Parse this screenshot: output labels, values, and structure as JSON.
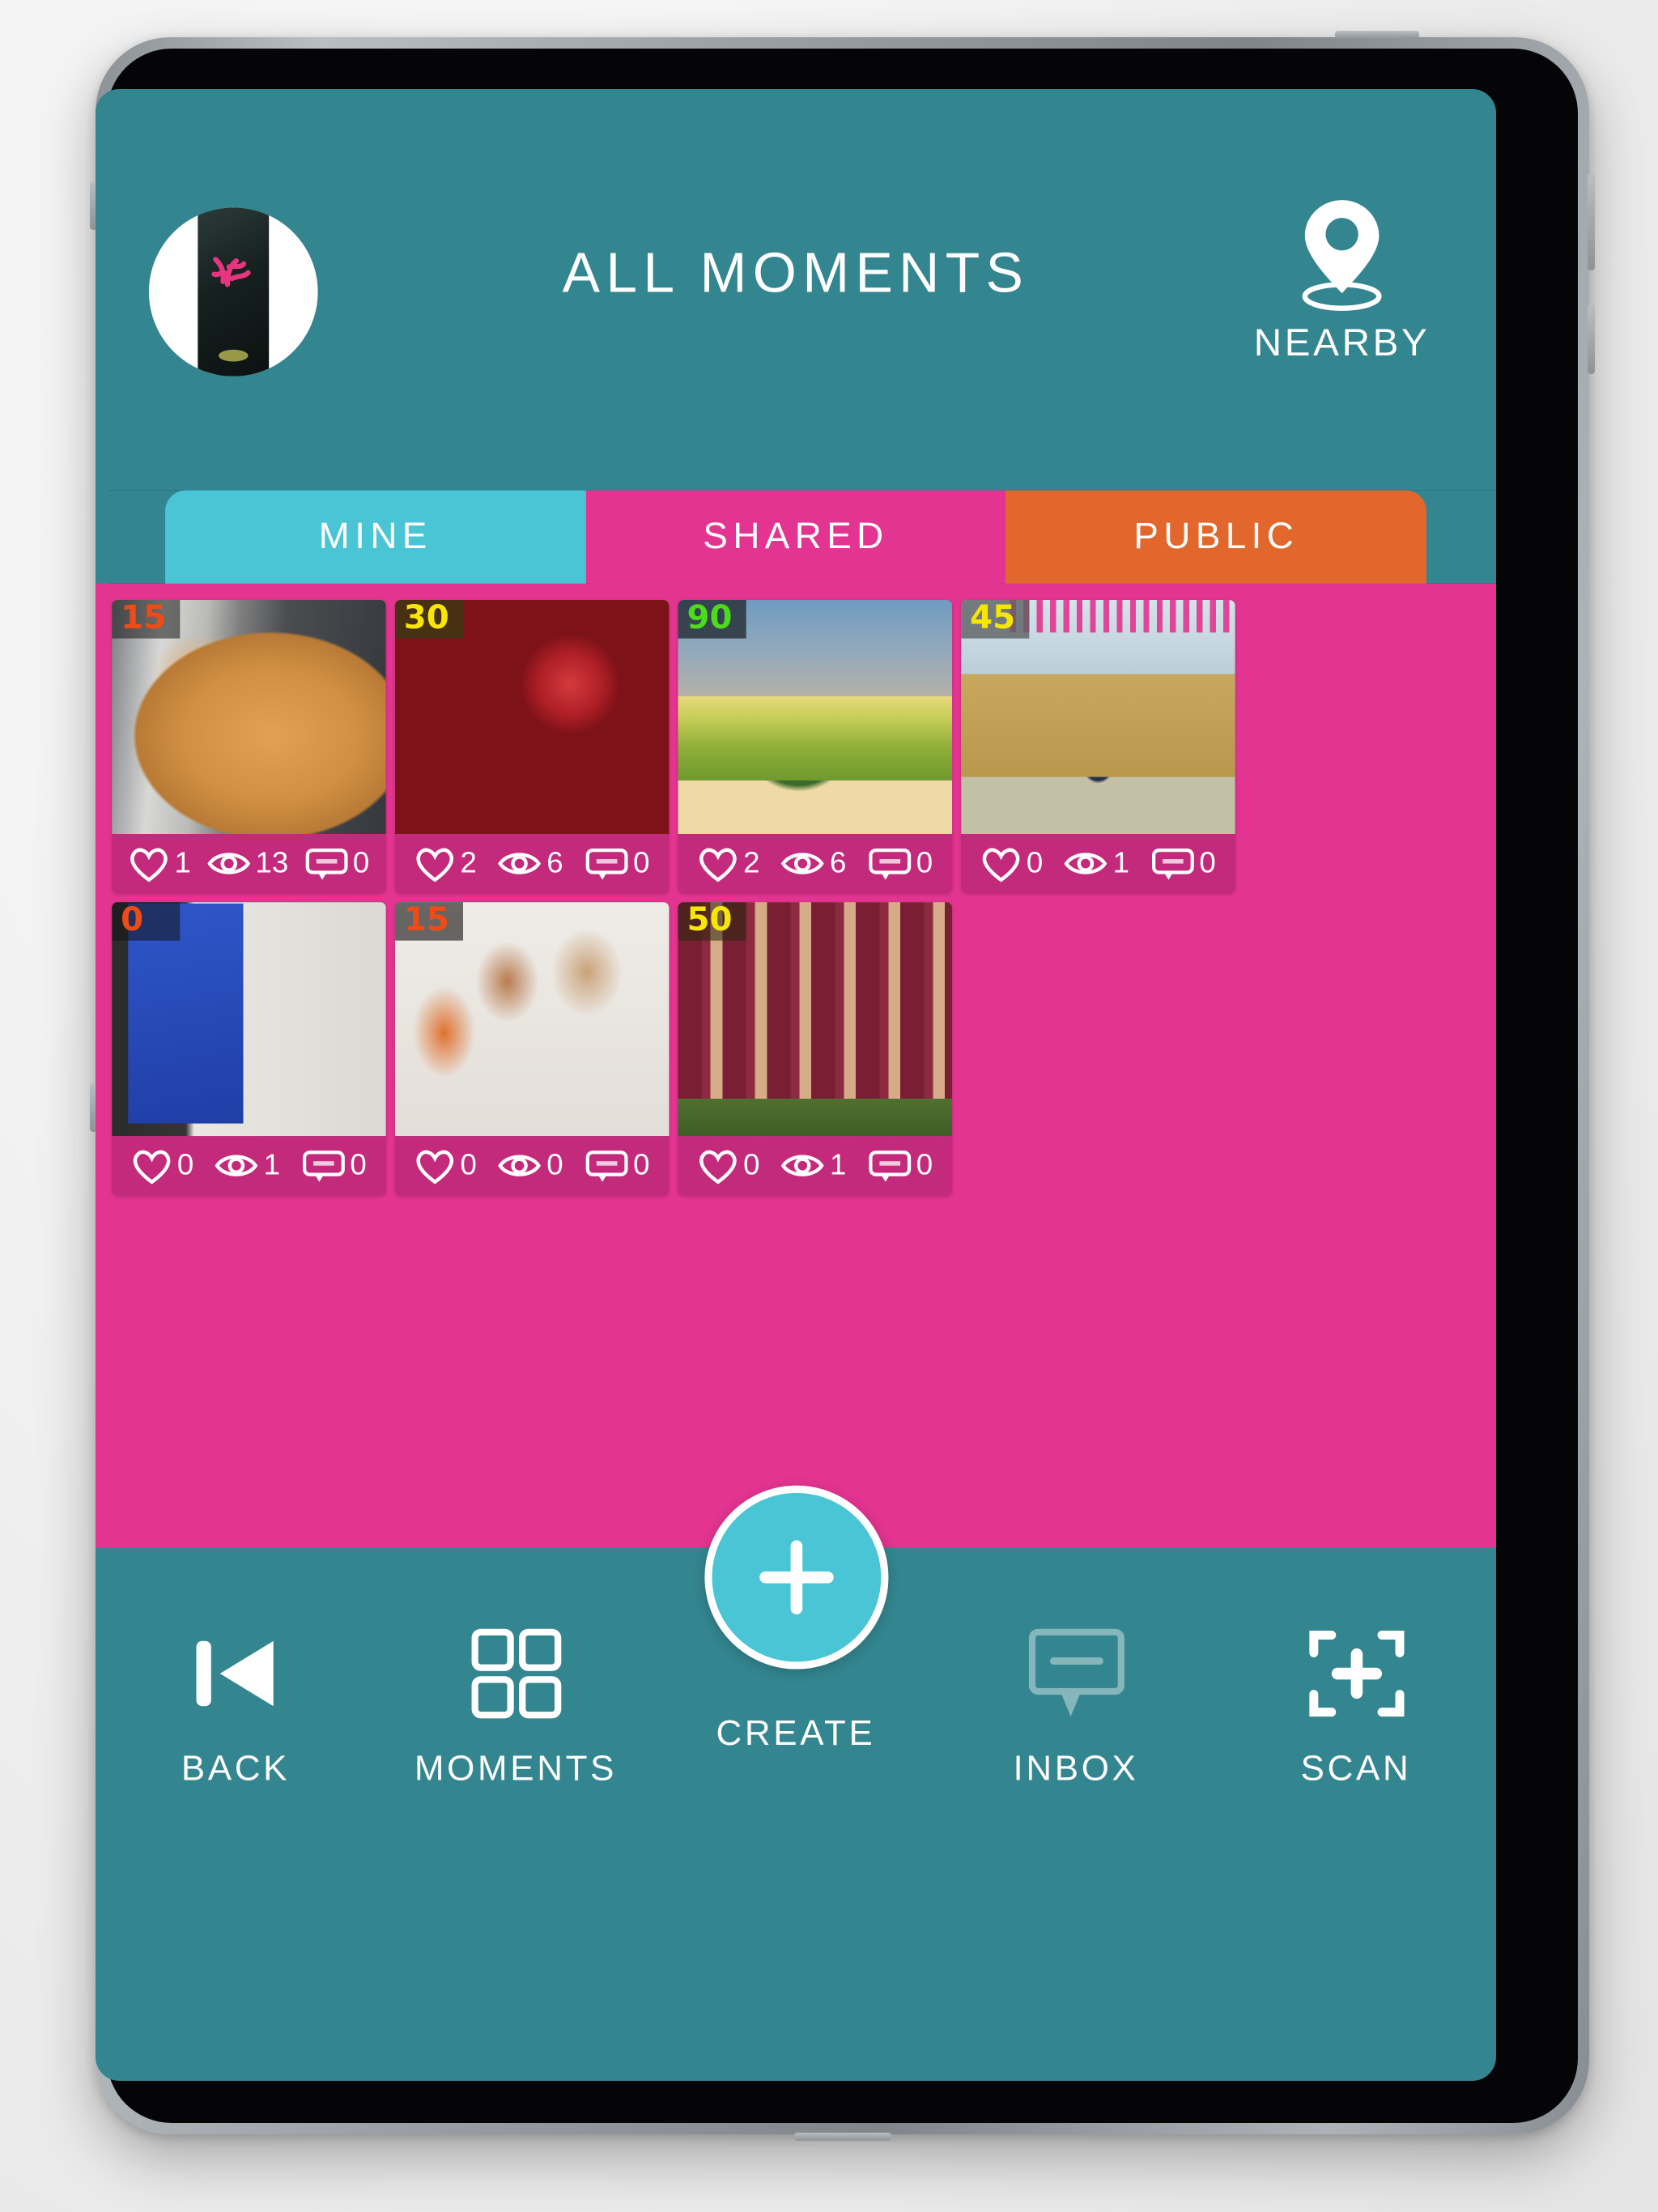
{
  "header": {
    "title": "ALL MOMENTS",
    "avatar_name": "user-avatar",
    "nearby_label": "NEARBY",
    "nearby_icon": "location-pin-icon"
  },
  "colors": {
    "teal": "#33858f",
    "pink": "#e23490",
    "cyan": "#49c5d6",
    "orange": "#e2672d",
    "card_footer": "#c32a7c"
  },
  "tabs": [
    {
      "label": "MINE",
      "active": true,
      "color": "#49c5d6"
    },
    {
      "label": "SHARED",
      "active": false,
      "color": "#e23490"
    },
    {
      "label": "PUBLIC",
      "active": false,
      "color": "#e2672d"
    }
  ],
  "cards": [
    {
      "badge": "15",
      "badge_color": "#ef4b16",
      "badge_bg": "rgba(20,20,20,0.55)",
      "art": "art-cat",
      "alt": "sleeping orange cat",
      "likes": "1",
      "views": "13",
      "comments": "0"
    },
    {
      "badge": "30",
      "badge_color": "#f6e600",
      "badge_bg": "rgba(58,57,18,0.78)",
      "art": "art-cricket",
      "alt": "cricket ball on bat",
      "likes": "2",
      "views": "6",
      "comments": "0"
    },
    {
      "badge": "90",
      "badge_color": "#4ddb1e",
      "badge_bg": "rgba(38,44,52,0.80)",
      "art": "art-landscape",
      "alt": "tree in green field",
      "likes": "2",
      "views": "6",
      "comments": "0"
    },
    {
      "badge": "45",
      "badge_color": "#f6e600",
      "badge_bg": "rgba(92,96,98,0.80)",
      "art": "art-field",
      "alt": "person standing in field",
      "likes": "0",
      "views": "1",
      "comments": "0"
    },
    {
      "badge": "0",
      "badge_color": "#ef4b16",
      "badge_bg": "rgba(20,20,20,0.55)",
      "art": "art-sushi",
      "alt": "sushi roll on blue plate",
      "likes": "0",
      "views": "1",
      "comments": "0"
    },
    {
      "badge": "15",
      "badge_color": "#ef4b16",
      "badge_bg": "rgba(20,20,20,0.62)",
      "art": "art-family",
      "alt": "father with two children",
      "likes": "0",
      "views": "0",
      "comments": "0"
    },
    {
      "badge": "50",
      "badge_color": "#f6e600",
      "badge_bg": "rgba(40,38,14,0.55)",
      "art": "art-team",
      "alt": "masked volleyball team",
      "likes": "0",
      "views": "1",
      "comments": "0"
    }
  ],
  "stat_icons": {
    "likes": "heart-icon",
    "views": "eye-icon",
    "comments": "comment-bubble-icon"
  },
  "bottom_nav": [
    {
      "label": "BACK",
      "icon": "skip-back-icon",
      "dim": false
    },
    {
      "label": "MOMENTS",
      "icon": "grid-squares-icon",
      "dim": false
    },
    {
      "label": "CREATE",
      "icon": "plus-circle-icon",
      "dim": false
    },
    {
      "label": "INBOX",
      "icon": "comment-bubble-icon",
      "dim": true
    },
    {
      "label": "SCAN",
      "icon": "scan-frame-plus-icon",
      "dim": false
    }
  ]
}
